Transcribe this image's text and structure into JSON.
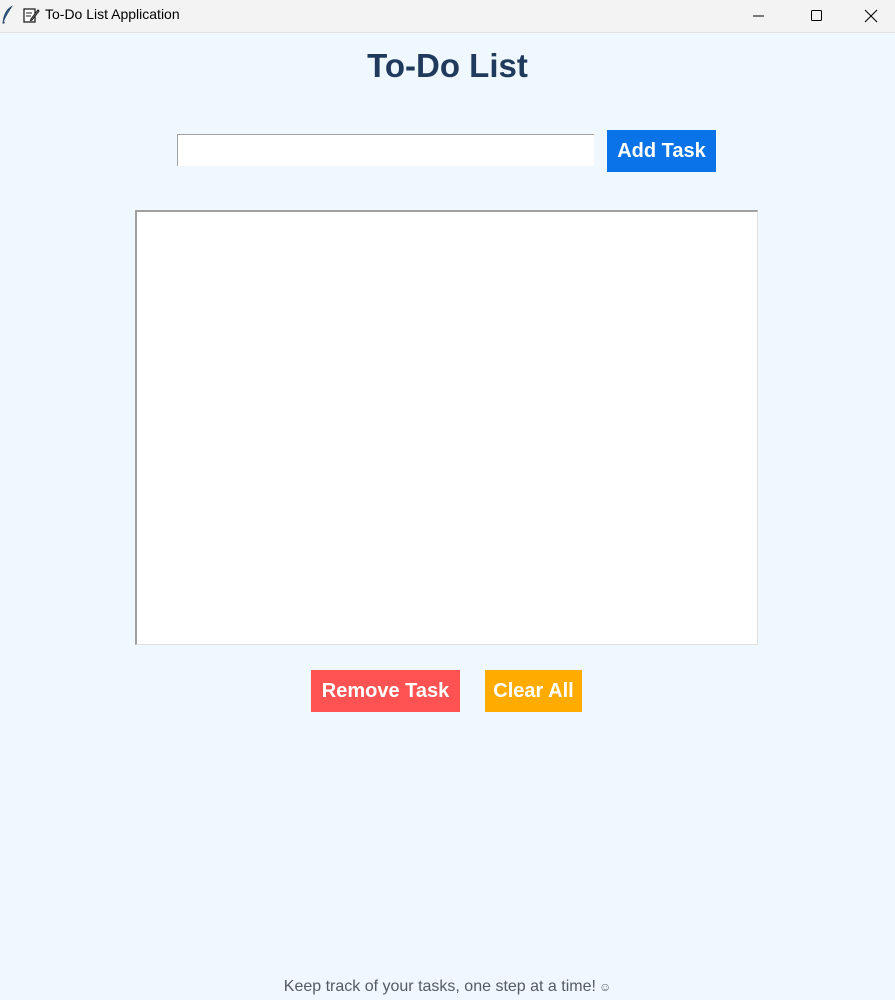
{
  "window": {
    "title": "To-Do List Application",
    "app_icon": "feather-icon",
    "title_icon": "memo-icon",
    "controls": {
      "minimize": "minimize-icon",
      "maximize": "maximize-icon",
      "close": "close-icon"
    }
  },
  "main": {
    "heading": "To-Do List",
    "task_input": {
      "value": "",
      "placeholder": ""
    },
    "add_button_label": "Add Task",
    "task_list": {
      "items": []
    },
    "remove_button_label": "Remove Task",
    "clear_button_label": "Clear All"
  },
  "footer": {
    "text": "Keep track of your tasks, one step at a time!",
    "emoji": "☺"
  },
  "colors": {
    "background": "#eff7ff",
    "heading": "#1f3a5c",
    "add_button": "#0a73e8",
    "remove_button": "#ff5252",
    "clear_button": "#ffab00",
    "footer_text": "#555b63"
  }
}
